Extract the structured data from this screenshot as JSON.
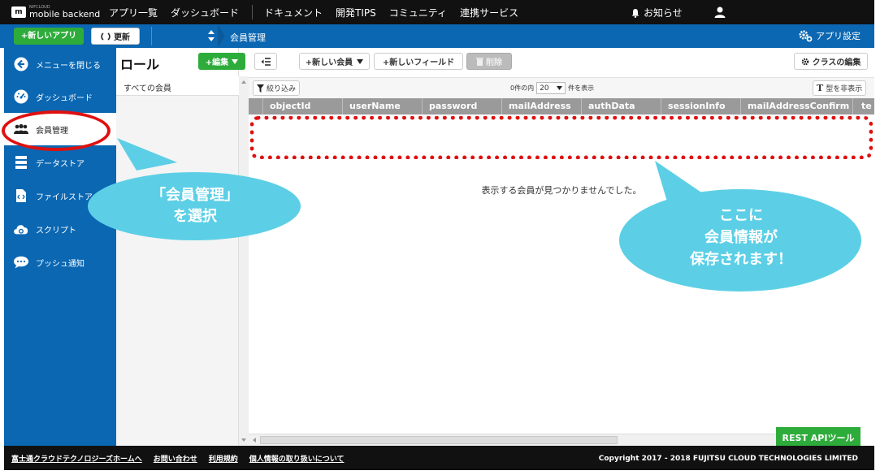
{
  "topnav": {
    "logo_small": "NIFCLOUD",
    "logo_main": "mobile backend",
    "links": [
      "アプリ一覧",
      "ダッシュボード",
      "ドキュメント",
      "開発TIPS",
      "コミュニティ",
      "連携サービス"
    ],
    "notice": "お知らせ"
  },
  "appbar": {
    "new_app": "+新しいアプリ",
    "refresh": "更新",
    "breadcrumb": "会員管理",
    "app_settings": "アプリ設定"
  },
  "sidebar": {
    "items": [
      {
        "label": "メニューを閉じる",
        "icon": "arrow-left-icon"
      },
      {
        "label": "ダッシュボード",
        "icon": "gauge-icon"
      },
      {
        "label": "会員管理",
        "icon": "users-icon"
      },
      {
        "label": "データストア",
        "icon": "database-icon"
      },
      {
        "label": "ファイルストア",
        "icon": "file-code-icon"
      },
      {
        "label": "スクリプト",
        "icon": "cloud-gear-icon"
      },
      {
        "label": "プッシュ通知",
        "icon": "chat-bubble-icon"
      }
    ],
    "active_index": 2
  },
  "roles": {
    "title": "ロール",
    "edit_button": "+編集",
    "items": [
      "すべての会員"
    ]
  },
  "main": {
    "toolbar": {
      "new_member": "+新しい会員",
      "new_field": "+新しいフィールド",
      "delete": "削除",
      "edit_class": "クラスの編集"
    },
    "filter": "絞り込み",
    "pager": {
      "prefix": "0件の内",
      "value": "20",
      "suffix": "件を表示"
    },
    "hide_types": "型を非表示",
    "columns": [
      "objectId",
      "userName",
      "password",
      "mailAddress",
      "authData",
      "sessionInfo",
      "mailAddressConfirm",
      "te"
    ],
    "empty_message": "表示する会員が見つかりませんでした。",
    "rest_api": "REST APIツール"
  },
  "footer": {
    "links": [
      "富士通クラウドテクノロジーズホームへ",
      "お問い合わせ",
      "利用規約",
      "個人情報の取り扱いについて"
    ],
    "copyright": "Copyright 2017 - 2018 FUJITSU CLOUD TECHNOLOGIES LIMITED"
  },
  "annotations": {
    "left_callout": [
      "「会員管理」",
      "を選択"
    ],
    "right_callout": [
      "ここに",
      "会員情報が",
      "保存されます！"
    ],
    "highlight_color": "#e01010",
    "callout_color": "#5ccfe6"
  },
  "colors": {
    "brand_blue": "#0b67b2",
    "accent_green": "#2eac3b",
    "header_dark": "#111111"
  }
}
